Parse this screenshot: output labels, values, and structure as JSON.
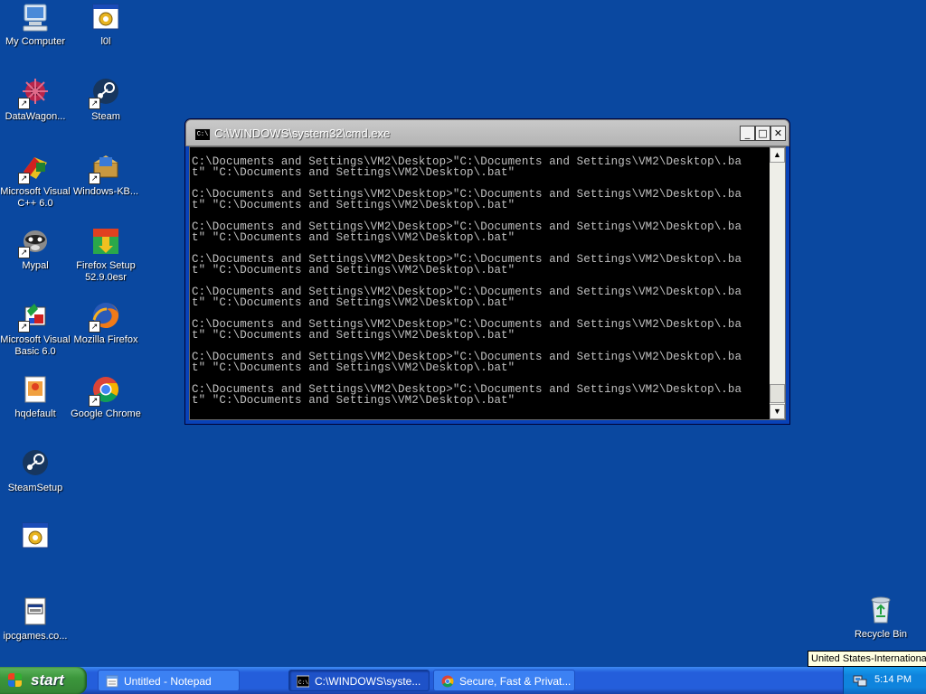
{
  "desktop": {
    "icons": [
      {
        "label": "My Computer"
      },
      {
        "label": "l0l"
      },
      {
        "label": "DataWagon..."
      },
      {
        "label": "Steam"
      },
      {
        "label": "Microsoft Visual C++ 6.0"
      },
      {
        "label": "Windows-KB..."
      },
      {
        "label": "Mypal"
      },
      {
        "label": "Firefox Setup 52.9.0esr"
      },
      {
        "label": "Microsoft Visual Basic 6.0"
      },
      {
        "label": "Mozilla Firefox"
      },
      {
        "label": "hqdefault"
      },
      {
        "label": "Google Chrome"
      },
      {
        "label": "SteamSetup"
      },
      {
        "label": ""
      },
      {
        "label": "ipcgames.co..."
      },
      {
        "label": "Recycle Bin"
      }
    ]
  },
  "cmd_window": {
    "title": "C:\\WINDOWS\\system32\\cmd.exe",
    "icon_text": "C:\\",
    "minimize_glyph": "_",
    "maximize_glyph": "□",
    "close_glyph": "✕",
    "line1": "C:\\Documents and Settings\\VM2\\Desktop>\"C:\\Documents and Settings\\VM2\\Desktop\\.ba",
    "line2": "t\" \"C:\\Documents and Settings\\VM2\\Desktop\\.bat\"",
    "repeat_count": 8
  },
  "taskbar": {
    "start_label": "start",
    "buttons": [
      {
        "label": "Untitled - Notepad"
      },
      {
        "label": "C:\\WINDOWS\\syste..."
      },
      {
        "label": "Secure, Fast & Privat..."
      }
    ],
    "clock": "5:14 PM",
    "tooltip": "United States-International"
  },
  "colors": {
    "desktop": "#0a48a0",
    "taskbar": "#245edb",
    "start": "#3c973c",
    "console_text": "#c0c0c0"
  }
}
